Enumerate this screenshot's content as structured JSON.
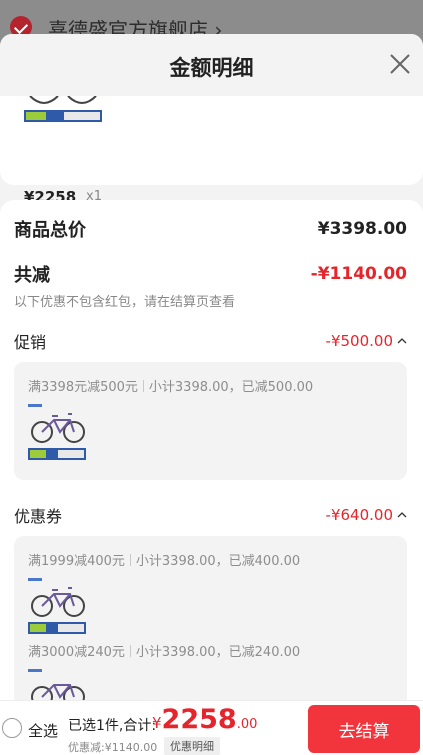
{
  "background": {
    "shop_name": "喜德盛官方旗舰店 ›"
  },
  "sheet": {
    "title": "金额明细"
  },
  "product": {
    "price": "¥2258",
    "quantity": "x1"
  },
  "summary": {
    "total_label": "商品总价",
    "total_value": "¥3398.00",
    "discount_label": "共减",
    "discount_value": "-¥1140.00",
    "discount_note": "以下优惠不包含红包，请在结算页查看"
  },
  "promotion": {
    "label": "促销",
    "value": "-¥500.00",
    "items": [
      {
        "rule": "满3398元减500元",
        "detail": "小计3398.00，已减500.00"
      }
    ]
  },
  "coupon": {
    "label": "优惠券",
    "value": "-¥640.00",
    "items": [
      {
        "rule": "满1999减400元",
        "detail": "小计3398.00，已减400.00"
      },
      {
        "rule": "满3000减240元",
        "detail": "小计3398.00，已减240.00"
      }
    ]
  },
  "footer": {
    "select_all": "全选",
    "selected_info": "已选1件,合计:",
    "total_currency": "¥",
    "total_int": "2258",
    "total_dec": ".00",
    "discount_line": "优惠减:¥1140.00",
    "detail_tag": "优惠明细",
    "checkout_label": "去结算"
  },
  "colors": {
    "accent": "#e5252c",
    "checkout_bg": "#f2343c",
    "box_bg": "#f3f3f3"
  }
}
